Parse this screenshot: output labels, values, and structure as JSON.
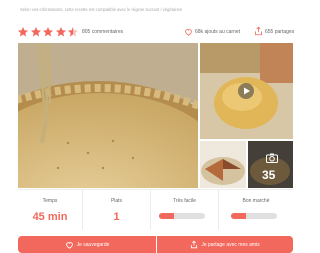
{
  "notice": "Selon vos informations, cette recette est compatible avec le régime sucrant / végétarien",
  "rating": {
    "stars": 4.5,
    "reviews": "805 commentaires",
    "favorites": "68k ajouts au carnet",
    "shares": "655 partages"
  },
  "gallery": {
    "more_photos": "35"
  },
  "stats": {
    "time": {
      "label": "Temps",
      "value": "45 min"
    },
    "dish": {
      "label": "Plats",
      "value": "1"
    },
    "difficulty": {
      "label": "Très facile",
      "level": 0.33
    },
    "cost": {
      "label": "Bon marché",
      "level": 0.33
    }
  },
  "actions": {
    "save": "Je sauvegarde",
    "share": "Je partage avec mes amis"
  },
  "colors": {
    "accent": "#f2685c",
    "star": "#f2685c"
  }
}
